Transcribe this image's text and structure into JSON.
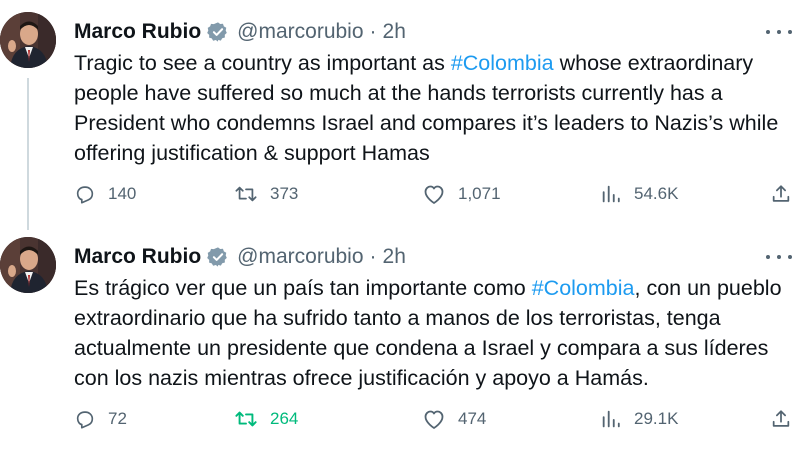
{
  "tweets": [
    {
      "author": {
        "name": "Marco Rubio",
        "handle": "@marcorubio",
        "verified": true,
        "separator": "·",
        "time": "2h"
      },
      "text_parts": [
        "Tragic to see a country as important as ",
        "#Colombia",
        " whose extraordinary people have suffered so much at the hands terrorists currently has a President who condemns Israel and compares it’s leaders to Nazis’s while offering justification & support Hamas"
      ],
      "stats": {
        "replies": "140",
        "retweets": "373",
        "likes": "1,071",
        "views": "54.6K"
      },
      "retweeted": false
    },
    {
      "author": {
        "name": "Marco Rubio",
        "handle": "@marcorubio",
        "verified": true,
        "separator": "·",
        "time": "2h"
      },
      "text_parts": [
        "Es trágico ver que un país tan importante como ",
        "#Colombia",
        ", con un pueblo extraordinario que ha sufrido tanto a manos de los terroristas, tenga actualmente un presidente que condena a Israel y compara a sus líderes con los nazis mientras ofrece justificación y apoyo a Hamás."
      ],
      "stats": {
        "replies": "72",
        "retweets": "264",
        "likes": "474",
        "views": "29.1K"
      },
      "retweeted": true
    }
  ],
  "icons": {
    "reply": "reply-icon",
    "retweet": "retweet-icon",
    "like": "heart-icon",
    "views": "views-icon",
    "share": "share-icon",
    "more": "more-icon",
    "verified": "verified-badge-icon"
  },
  "colors": {
    "hashtag": "#1d9bf0",
    "verified": "#829aab",
    "retweeted": "#00ba7c",
    "secondary_text": "#536471"
  }
}
